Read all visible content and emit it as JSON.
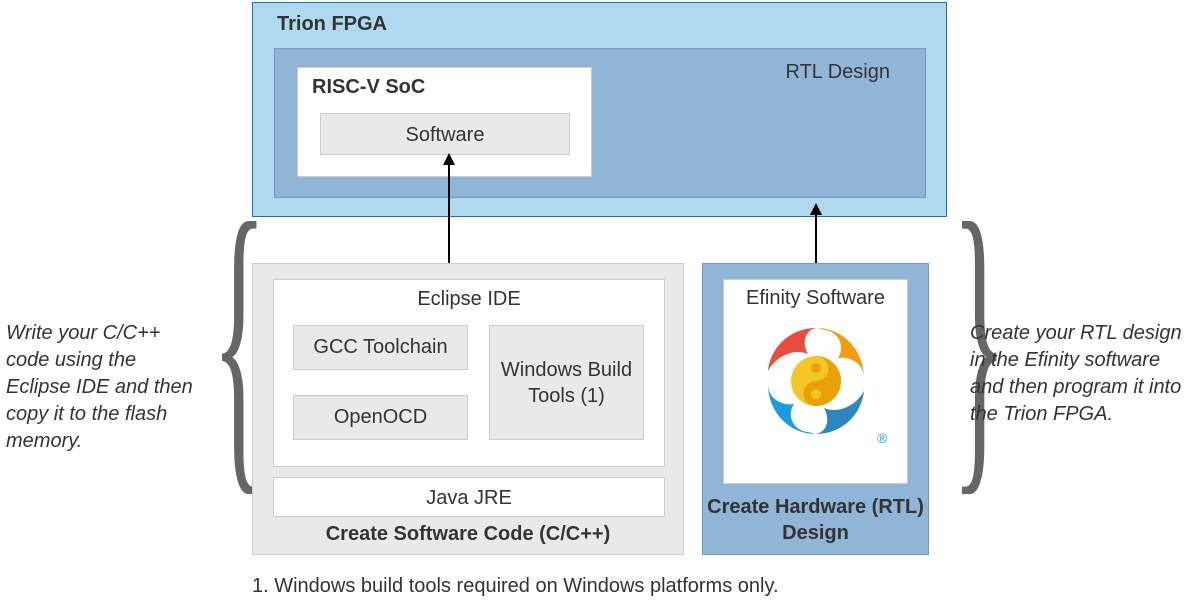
{
  "fpga": {
    "title": "Trion FPGA",
    "rtl_label": "RTL Design",
    "soc_title": "RISC-V SoC",
    "software_label": "Software"
  },
  "sw": {
    "eclipse": "Eclipse IDE",
    "gcc": "GCC Toolchain",
    "openocd": "OpenOCD",
    "wintools": "Windows Build Tools (1)",
    "java": "Java JRE",
    "title": "Create Software Code (C/C++)"
  },
  "hw": {
    "efinity": "Efinity Software",
    "title": "Create Hardware (RTL) Design",
    "reg": "®"
  },
  "side": {
    "left": "Write your C/C++ code using the Eclipse IDE and then copy it to the flash memory.",
    "right": "Create your RTL design in the Efinity software and then program it into the Trion FPGA."
  },
  "footnote": "1. Windows build tools required on Windows platforms only."
}
